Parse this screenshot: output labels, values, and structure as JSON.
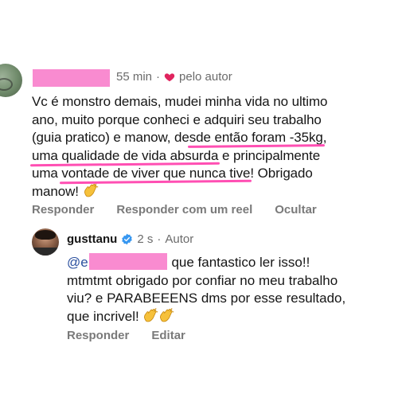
{
  "comment": {
    "time": "55 min",
    "separator": "·",
    "liked_label": "pelo autor",
    "text_lines": [
      [
        "Vc é monstro demais, mudei minha vida no ultimo"
      ],
      [
        "ano, muito porque conheci e adquiri seu trabalho"
      ],
      [
        "(guia pratico) e manow, de",
        "sde então foram -35kg",
        ","
      ],
      [
        "uma qualidade de vida absurda",
        " e principalmente"
      ],
      [
        "uma ",
        "vontade de viver que nunca tive",
        "! Obrigado"
      ],
      [
        "manow! "
      ]
    ],
    "emoji": "clapping-hands",
    "actions": [
      "Responder",
      "Responder com um reel",
      "Ocultar"
    ]
  },
  "reply": {
    "username": "gusttanu",
    "time": "2 s",
    "separator": "·",
    "role": "Autor",
    "mention_prefix": "@e",
    "line1_rest": " que fantastico ler isso!!",
    "line2": "mtmtmt obrigado por confiar no meu trabalho",
    "line3": "viu? e PARABEEENS dms por esse resultado,",
    "line4": "que incrivel! ",
    "emoji": "clapping-hands x2",
    "actions": [
      "Responder",
      "Editar"
    ]
  },
  "colors": {
    "highlight": "#ff4fb3",
    "redaction": "#f98bd0",
    "heart": "#e0245e",
    "verified": "#3797f0",
    "muted": "#6b6b6b"
  }
}
